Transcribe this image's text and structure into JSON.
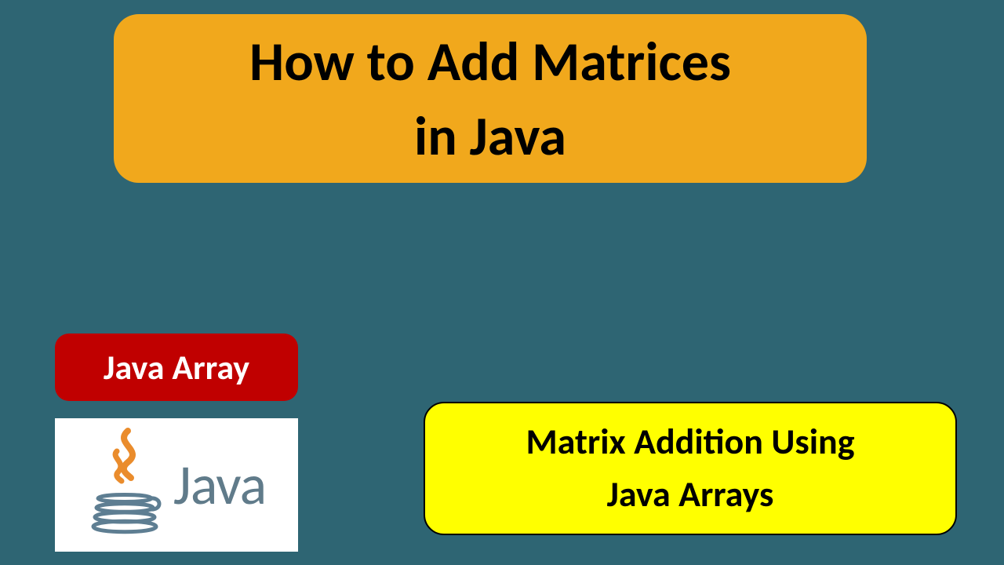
{
  "title": {
    "line1": "How to Add Matrices",
    "line2": "in Java"
  },
  "tag": "Java Array",
  "logo_text": "Java",
  "subtitle": {
    "line1": "Matrix Addition Using",
    "line2": "Java Arrays"
  },
  "colors": {
    "background": "#2e6573",
    "title_bg": "#f1a81c",
    "tag_bg": "#c00000",
    "subtitle_bg": "#ffff00",
    "java_steam": "#ea8c2c",
    "java_cup": "#5e7e92"
  }
}
